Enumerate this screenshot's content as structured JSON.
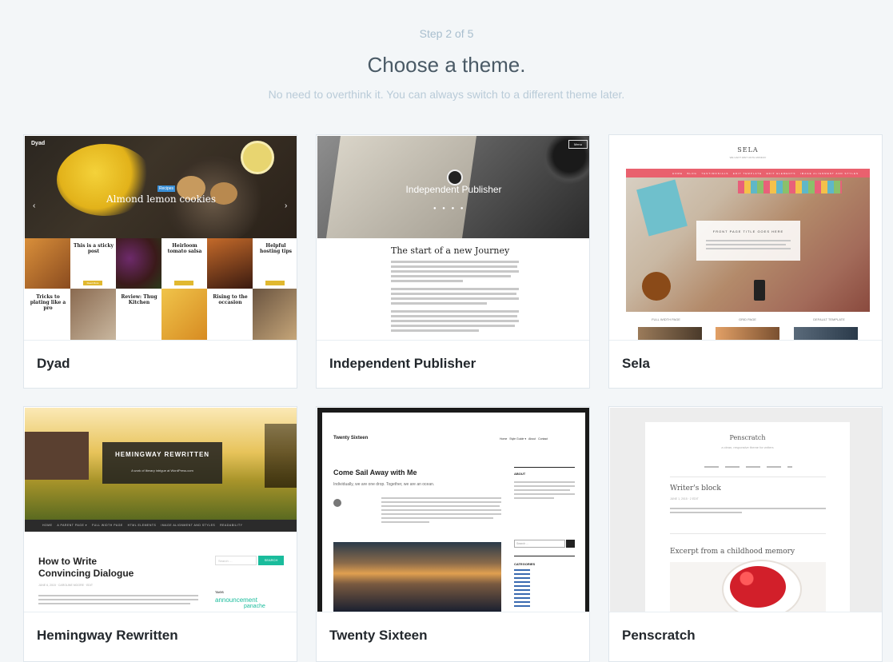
{
  "header": {
    "step": "Step 2 of 5",
    "title": "Choose a theme.",
    "subtitle": "No need to overthink it. You can always switch to a different theme later."
  },
  "themes": [
    {
      "name": "Dyad",
      "preview": {
        "site_title": "Dyad",
        "tag": "Recipes",
        "hero_title": "Almond lemon cookies",
        "tiles": [
          "This is a sticky post",
          "Heirloom tomato salsa",
          "Helpful hosting tips",
          "Tricks to plating like a pro",
          "Review: Thug Kitchen",
          "Rising to the occasion"
        ],
        "read_more": "Read More"
      }
    },
    {
      "name": "Independent Publisher",
      "preview": {
        "hero_title": "Independent Publisher",
        "menu": "Menu",
        "post_title": "The start of a new Journey"
      }
    },
    {
      "name": "Sela",
      "preview": {
        "site_title": "SELA",
        "tagline": "WE CAN'T WAIT UNTIL MONDAY",
        "nav": [
          "HOME",
          "BLOG",
          "TESTIMONIALS",
          "EDIT TEMPLATE",
          "EDIT ELEMENTS",
          "IMAGE ALIGNMENT AND STYLES"
        ],
        "box_title": "FRONT PAGE TITLE GOES HERE",
        "columns": [
          "FULL WIDTH PAGE",
          "GRID PAGE",
          "DEFAULT TEMPLATE"
        ]
      }
    },
    {
      "name": "Hemingway Rewritten",
      "preview": {
        "site_title": "HEMINGWAY REWRITTEN",
        "tagline": "A work of literary intrigue at WordPress.com",
        "nav": [
          "HOME",
          "A PARENT PAGE ▾",
          "FULL WIDTH PAGE",
          "HTML ELEMENTS",
          "IMAGE ALIGNMENT AND STYLES",
          "READABILITY"
        ],
        "post_title": "How to Write Convincing Dialogue",
        "meta": "JUNE 6, 2015 · CAROLINE MOORE · EDIT",
        "search_placeholder": "Search …",
        "search_button": "SEARCH",
        "tags_label": "TAGS",
        "tag1": "announcement",
        "tag2": "panache"
      }
    },
    {
      "name": "Twenty Sixteen",
      "preview": {
        "site_title": "Twenty Sixteen",
        "nav": [
          "Home",
          "Style Guide ▾",
          "About",
          "Contact"
        ],
        "post_title": "Come Sail Away with Me",
        "excerpt": "Individually, we are one drop. Together, we are an ocean.",
        "about_label": "ABOUT",
        "search_placeholder": "Search …",
        "categories_label": "CATEGORIES"
      }
    },
    {
      "name": "Penscratch",
      "preview": {
        "site_title": "Penscratch",
        "tagline": "a clean, responsive theme for writers",
        "post1": "Writer's block",
        "meta1": "JUNE 1, 2015 · 2 EDIT",
        "post2": "Excerpt from a childhood memory"
      }
    }
  ]
}
